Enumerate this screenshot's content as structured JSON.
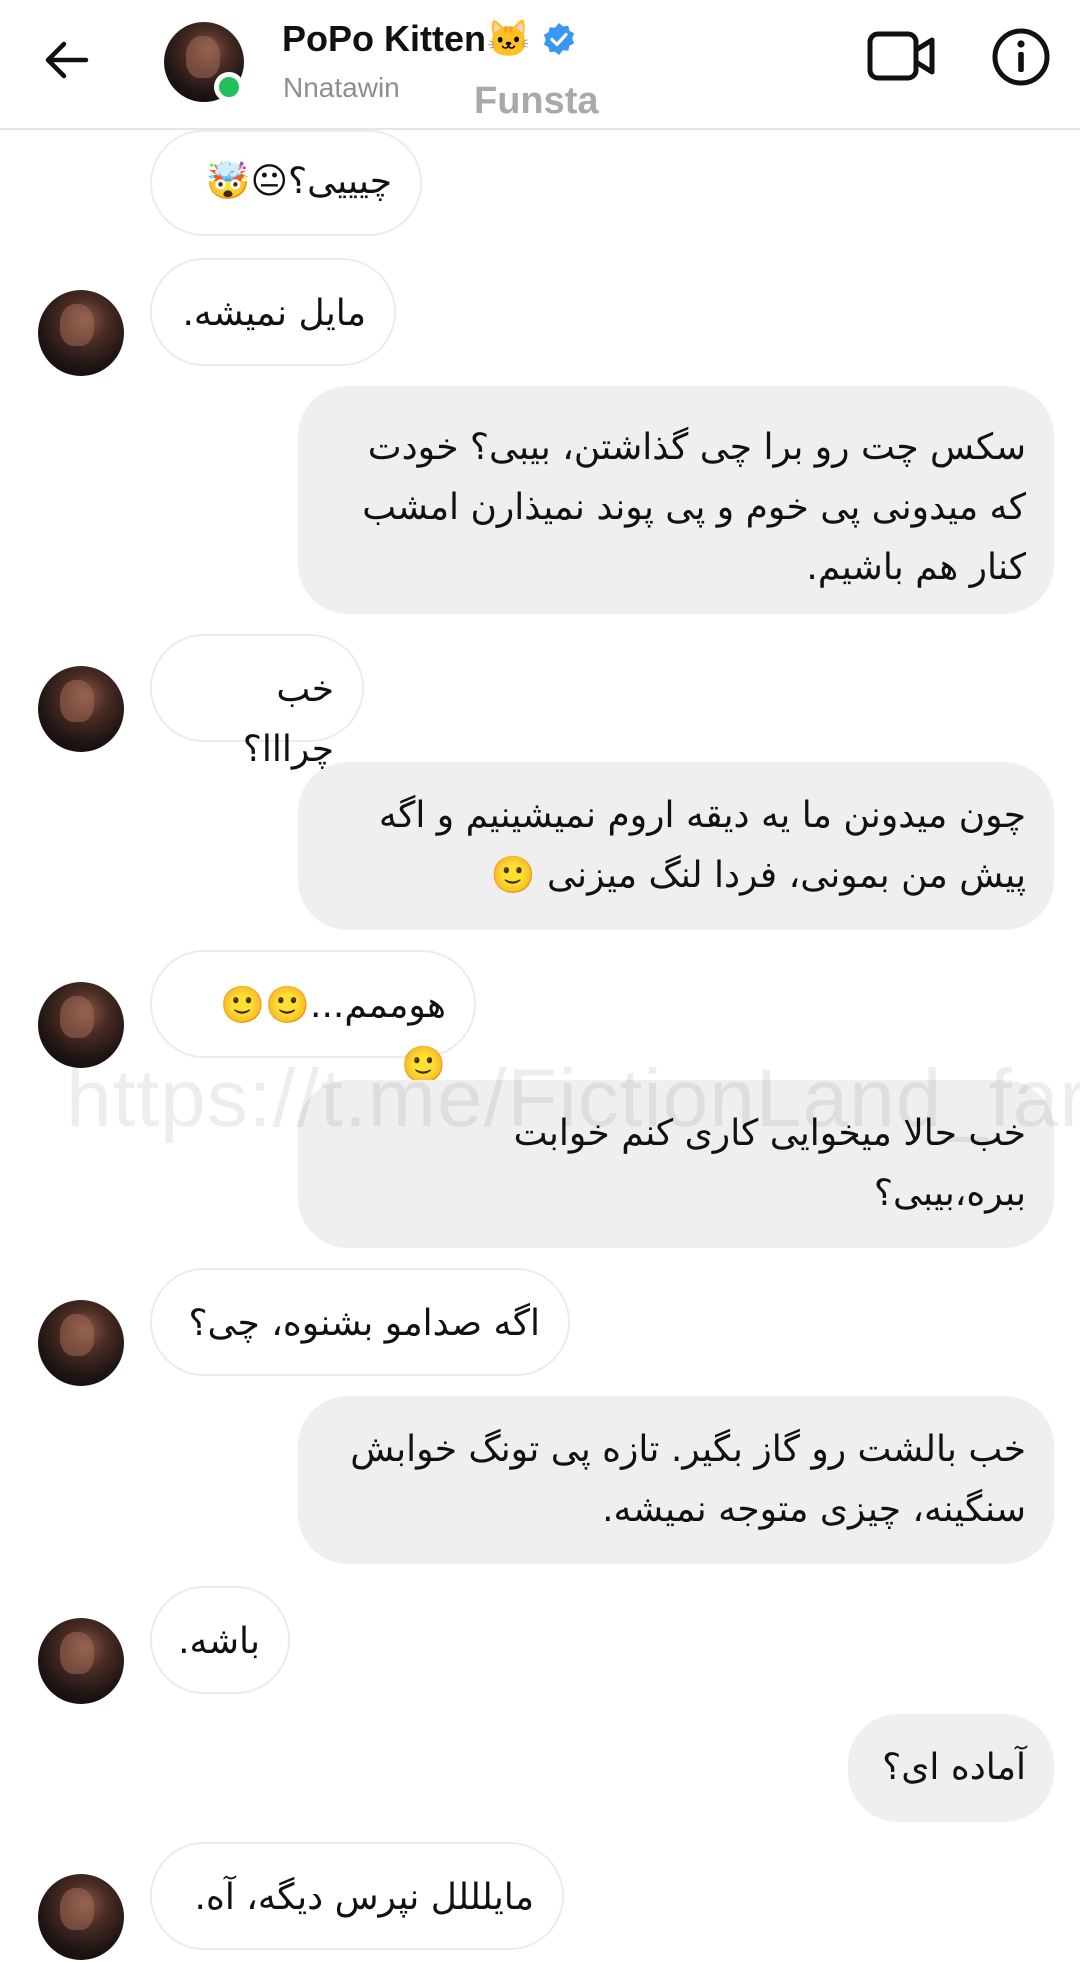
{
  "header": {
    "name": "PoPo Kitten🐱",
    "username": "Nnatawin",
    "watermark_label": "Funsta",
    "verified_icon": "verified-badge-icon",
    "colors": {
      "verified": "#3897f0",
      "online": "#21c05b"
    }
  },
  "watermark": "https://t.me/FictionLand_farsi",
  "messages": [
    {
      "side": "in",
      "text": "چیییی؟😐🤯",
      "avatar": false
    },
    {
      "side": "in",
      "text": "مایل نمیشه.",
      "avatar": true
    },
    {
      "side": "out",
      "lines": [
        "سکس چت رو برا چی گذاشتن، بیبی؟ خودت",
        "که میدونی پی خوم و پی پوند نمیذارن امشب",
        "کنار هم باشیم."
      ]
    },
    {
      "side": "in",
      "text": "خب چرااا؟",
      "avatar": true
    },
    {
      "side": "out",
      "lines": [
        "چون میدونن ما یه دیقه اروم نمیشینیم و اگه",
        "پیش من بمونی، فردا لنگ میزنی 🙂"
      ]
    },
    {
      "side": "in",
      "text": "هوممم...🙂🙂🙂",
      "avatar": true
    },
    {
      "side": "out",
      "lines": [
        "خب حالا میخوایی کاری کنم خوابت",
        "ببره،بیبی؟"
      ]
    },
    {
      "side": "in",
      "text": "اگه صدامو بشنوه، چی؟",
      "avatar": true
    },
    {
      "side": "out",
      "lines": [
        "خب بالشت رو گاز بگیر. تازه پی تونگ خوابش",
        "سنگینه، چیزی متوجه نمیشه."
      ]
    },
    {
      "side": "in",
      "text": "باشه.",
      "avatar": true
    },
    {
      "side": "out",
      "lines": [
        "آماده ای؟"
      ]
    },
    {
      "side": "in",
      "text": "مایلللل نپرس دیگه، آه.",
      "avatar": true
    }
  ]
}
